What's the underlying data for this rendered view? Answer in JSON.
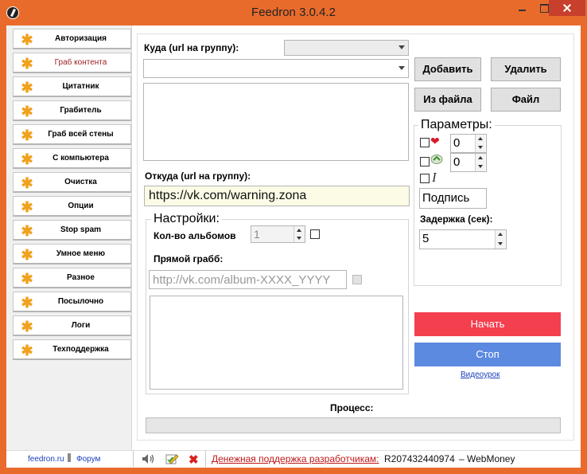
{
  "window": {
    "title": "Feedron 3.0.4.2"
  },
  "nav": {
    "items": [
      {
        "label": "Авторизация",
        "active": false
      },
      {
        "label": "Граб контента",
        "active": true
      },
      {
        "label": "Цитатник",
        "active": false
      },
      {
        "label": "Грабитель",
        "active": false
      },
      {
        "label": "Граб всей стены",
        "active": false
      },
      {
        "label": "С компьютера",
        "active": false
      },
      {
        "label": "Очистка",
        "active": false
      },
      {
        "label": "Опции",
        "active": false
      },
      {
        "label": "Stop spam",
        "active": false
      },
      {
        "label": "Умное меню",
        "active": false
      },
      {
        "label": "Разное",
        "active": false
      },
      {
        "label": "Посылочно",
        "active": false
      },
      {
        "label": "Логи",
        "active": false
      },
      {
        "label": "Техподдержка",
        "active": false
      }
    ]
  },
  "target": {
    "label": "Куда (url на группу):",
    "url_value": "",
    "select_value": ""
  },
  "source": {
    "label": "Откуда (url на группу):",
    "url_value": "https://vk.com/warning.zona"
  },
  "buttons": {
    "add": "Добавить",
    "delete": "Удалить",
    "from_file": "Из файла",
    "file": "Файл",
    "start": "Начать",
    "stop": "Стоп"
  },
  "settings": {
    "title": "Настройки:",
    "albums_label": "Кол-во альбомов",
    "albums_value": "1",
    "direct_grab_label": "Прямой грабб:",
    "album_placeholder": "http://vk.com/album-XXXX_YYYY"
  },
  "params": {
    "title": "Параметры:",
    "likes_value": "0",
    "reposts_value": "0",
    "signature_value": "Подпись",
    "delay_label": "Задержка (сек):",
    "delay_value": "5"
  },
  "video_link": "Видеоурок",
  "process": {
    "label": "Процесс:",
    "progress": 0
  },
  "statusbar": {
    "site_link": "feedron.ru",
    "forum_link": "Форум",
    "support_link": "Денежная поддержка разработчикам:",
    "wallet": "R207432440974",
    "wallet_suffix": "– WebMoney"
  },
  "colors": {
    "accent": "#e96b2c",
    "start_button": "#f43f4f",
    "stop_button": "#5b8ae0",
    "active_nav": "#9b1b1b",
    "link": "#1a3fb8",
    "support_link": "#c01818"
  },
  "icons": {
    "nav_item": "star-icon",
    "likes": "heart-icon",
    "reposts": "repost-icon",
    "italic": "italic-icon",
    "sound": "speaker-icon",
    "edit": "pencil-icon",
    "close": "close-icon"
  }
}
